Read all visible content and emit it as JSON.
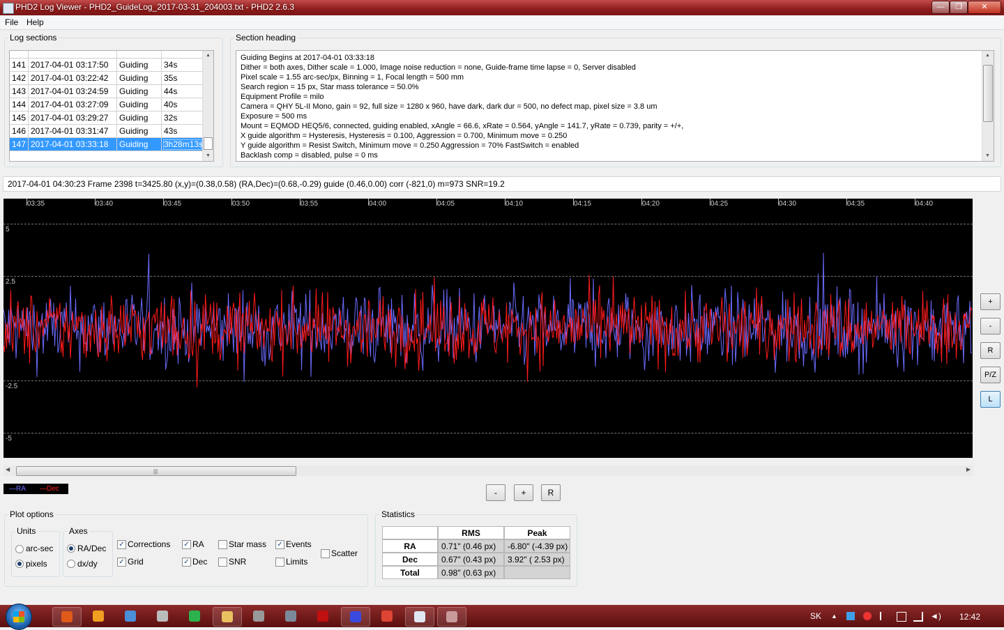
{
  "window": {
    "title": "PHD2 Log Viewer - PHD2_GuideLog_2017-03-31_204003.txt - PHD2 2.6.3",
    "minimize": "—",
    "maximize": "❐",
    "close": "✕"
  },
  "menu": {
    "file": "File",
    "help": "Help"
  },
  "log_sections": {
    "label": "Log sections",
    "rows": [
      {
        "n": "141",
        "date": "2017-04-01 03:17:50",
        "type": "Guiding",
        "dur": "34s"
      },
      {
        "n": "142",
        "date": "2017-04-01 03:22:42",
        "type": "Guiding",
        "dur": "35s"
      },
      {
        "n": "143",
        "date": "2017-04-01 03:24:59",
        "type": "Guiding",
        "dur": "44s"
      },
      {
        "n": "144",
        "date": "2017-04-01 03:27:09",
        "type": "Guiding",
        "dur": "40s"
      },
      {
        "n": "145",
        "date": "2017-04-01 03:29:27",
        "type": "Guiding",
        "dur": "32s"
      },
      {
        "n": "146",
        "date": "2017-04-01 03:31:47",
        "type": "Guiding",
        "dur": "43s"
      },
      {
        "n": "147",
        "date": "2017-04-01 03:33:18",
        "type": "Guiding",
        "dur": "3h28m13s"
      }
    ]
  },
  "section_heading": {
    "label": "Section heading",
    "lines": [
      "Guiding Begins at 2017-04-01 03:33:18",
      "Dither = both axes, Dither scale = 1.000, Image noise reduction = none, Guide-frame time lapse = 0, Server disabled",
      "Pixel scale = 1.55 arc-sec/px, Binning = 1, Focal length = 500 mm",
      "Search region = 15 px, Star mass tolerance = 50.0%",
      "Equipment Profile = milo",
      "Camera = QHY 5L-II Mono, gain = 92, full size = 1280 x 960, have dark, dark dur = 500, no defect map, pixel size = 3.8 um",
      "Exposure = 500 ms",
      "Mount = EQMOD HEQ5/6,  connected, guiding enabled, xAngle = 66.6, xRate = 0.564, yAngle = 141.7, yRate = 0.739, parity = +/+,",
      "X guide algorithm = Hysteresis, Hysteresis = 0.100, Aggression = 0.700, Minimum move = 0.250",
      "Y guide algorithm = Resist Switch, Minimum move = 0.250 Aggression = 70% FastSwitch = enabled",
      "Backlash comp = disabled, pulse = 0 ms"
    ]
  },
  "status_line": "2017-04-01 04:30:23 Frame 2398 t=3425.80 (x,y)=(0.38,0.58) (RA,Dec)=(0.68,-0.29) guide (0.46,0.00) corr (-821,0) m=973 SNR=19.2",
  "graph_buttons": {
    "zoom_in": "+",
    "zoom_out": "-",
    "reset": "R",
    "pz": "P/Z",
    "l": "L"
  },
  "bottom_buttons": {
    "minus": "-",
    "plus": "+",
    "reset": "R"
  },
  "legend": {
    "ra": "—RA",
    "dec": "—Dec"
  },
  "plot_options": {
    "label": "Plot options",
    "units": {
      "label": "Units",
      "arcsec": "arc-sec",
      "pixels": "pixels",
      "selected": "pixels"
    },
    "axes": {
      "label": "Axes",
      "radec": "RA/Dec",
      "dxdy": "dx/dy",
      "selected": "RA/Dec"
    },
    "checks": [
      {
        "id": "corrections",
        "label": "Corrections",
        "checked": true
      },
      {
        "id": "grid",
        "label": "Grid",
        "checked": true
      },
      {
        "id": "ra",
        "label": "RA",
        "checked": true
      },
      {
        "id": "dec",
        "label": "Dec",
        "checked": true
      },
      {
        "id": "starmass",
        "label": "Star mass",
        "checked": false
      },
      {
        "id": "snr",
        "label": "SNR",
        "checked": false
      },
      {
        "id": "events",
        "label": "Events",
        "checked": true
      },
      {
        "id": "limits",
        "label": "Limits",
        "checked": false
      },
      {
        "id": "scatter",
        "label": "Scatter",
        "checked": false
      }
    ]
  },
  "statistics": {
    "label": "Statistics",
    "headers": [
      "RMS",
      "Peak"
    ],
    "rows": [
      {
        "name": "RA",
        "rms": "0.71\" (0.46 px)",
        "peak": "-6.80\" (-4.39 px)"
      },
      {
        "name": "Dec",
        "rms": "0.67\" (0.43 px)",
        "peak": "3.92\" ( 2.53 px)"
      },
      {
        "name": "Total",
        "rms": "0.98\" (0.63 px)",
        "peak": ""
      }
    ]
  },
  "chart_data": {
    "type": "line",
    "x_ticks": [
      "03:35",
      "03:40",
      "03:45",
      "03:50",
      "03:55",
      "04:00",
      "04:05",
      "04:10",
      "04:15",
      "04:20",
      "04:25",
      "04:30",
      "04:35",
      "04:40"
    ],
    "y_ticks": [
      "5",
      "2.5",
      "-2.5",
      "-5"
    ],
    "ylim": [
      -6.2,
      6.2
    ],
    "grid": true,
    "series": [
      {
        "name": "RA",
        "color": "#6b6bff"
      },
      {
        "name": "Dec",
        "color": "#ff1a1a"
      }
    ]
  },
  "taskbar": {
    "lang": "SK",
    "clock": "12:42"
  }
}
